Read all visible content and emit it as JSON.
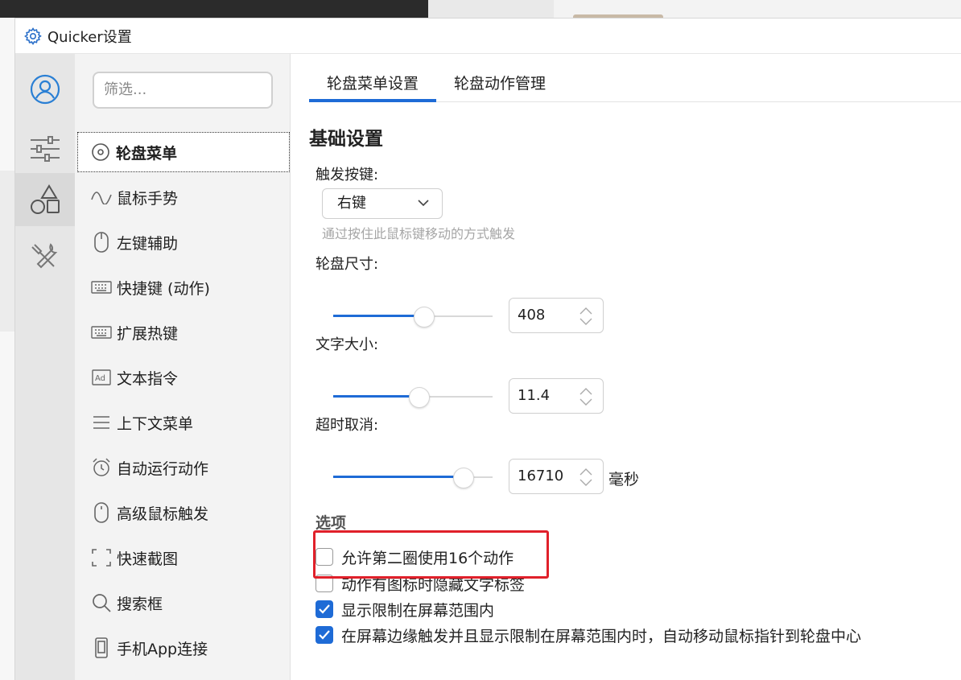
{
  "window": {
    "title": "Quicker设置"
  },
  "filter": {
    "placeholder": "筛选..."
  },
  "nav": {
    "items": [
      {
        "label": "轮盘菜单",
        "icon": "wheel-icon",
        "active": true
      },
      {
        "label": "鼠标手势",
        "icon": "gesture-icon",
        "active": false
      },
      {
        "label": "左键辅助",
        "icon": "mouse-icon",
        "active": false
      },
      {
        "label": "快捷键 (动作)",
        "icon": "keyboard-icon",
        "active": false
      },
      {
        "label": "扩展热键",
        "icon": "keyboard-icon",
        "active": false
      },
      {
        "label": "文本指令",
        "icon": "ad-icon",
        "active": false
      },
      {
        "label": "上下文菜单",
        "icon": "menu-icon",
        "active": false
      },
      {
        "label": "自动运行动作",
        "icon": "alarm-icon",
        "active": false
      },
      {
        "label": "高级鼠标触发",
        "icon": "mouse-icon",
        "active": false
      },
      {
        "label": "快速截图",
        "icon": "screenshot-icon",
        "active": false
      },
      {
        "label": "搜索框",
        "icon": "search-icon",
        "active": false
      },
      {
        "label": "手机App连接",
        "icon": "phone-icon",
        "active": false
      }
    ]
  },
  "tabs": [
    {
      "label": "轮盘菜单设置",
      "active": true
    },
    {
      "label": "轮盘动作管理",
      "active": false
    }
  ],
  "basic": {
    "title": "基础设置",
    "trigger_label": "触发按键:",
    "trigger_value": "右键",
    "trigger_hint": "通过按住此鼠标键移动的方式触发",
    "size_label": "轮盘尺寸:",
    "size_value": "408",
    "size_level": 0.57,
    "font_label": "文字大小:",
    "font_value": "11.4",
    "font_level": 0.54,
    "timeout_label": "超时取消:",
    "timeout_value": "16710",
    "timeout_level": 0.82,
    "timeout_unit": "毫秒"
  },
  "options": {
    "title": "选项",
    "items": [
      {
        "label": "允许第二圈使用16个动作",
        "checked": false
      },
      {
        "label": "动作有图标时隐藏文字标签",
        "checked": false
      },
      {
        "label": "显示限制在屏幕范围内",
        "checked": true
      },
      {
        "label": "在屏幕边缘触发并且显示限制在屏幕范围内时，自动移动鼠标指针到轮盘中心",
        "checked": true
      }
    ]
  },
  "colors": {
    "accent": "#1e6bd6",
    "highlight": "#e0202a"
  }
}
